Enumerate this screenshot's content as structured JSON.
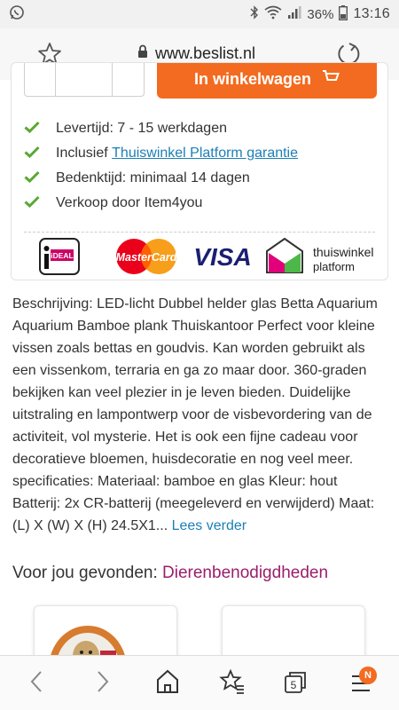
{
  "status_bar": {
    "battery": "36%",
    "time": "13:16"
  },
  "browser": {
    "url": "www.beslist.nl",
    "tab_count": "5",
    "menu_badge": "N"
  },
  "product": {
    "cart_button_label": "In winkelwagen",
    "features": [
      {
        "prefix": "Levertijd: 7 - 15 werkdagen",
        "link": ""
      },
      {
        "prefix": "Inclusief ",
        "link": "Thuiswinkel Platform garantie"
      },
      {
        "prefix": "Bedenktijd: minimaal 14 dagen",
        "link": ""
      },
      {
        "prefix": "Verkoop door Item4you",
        "link": ""
      }
    ],
    "payment_logos": {
      "ideal": "iDEAL",
      "mastercard": "MasterCard",
      "visa": "VISA",
      "thuiswinkel_line1": "thuiswinkel",
      "thuiswinkel_line2": "platform"
    }
  },
  "description": {
    "text": "Beschrijving: LED-licht Dubbel helder glas Betta Aquarium Aquarium Bamboe plank Thuiskantoor Perfect voor kleine vissen zoals bettas en goudvis. Kan worden gebruikt als een vissenkom, terraria en ga zo maar door. 360-graden bekijken kan veel plezier in je leven bieden. Duidelijke uitstraling en lampontwerp voor de visbevordering van de activiteit, vol mysterie. Het is ook een fijne cadeau voor decoratieve bloemen, huisdecoratie en nog veel meer. specificaties: Materiaal: bamboe en glas Kleur: hout Batterij: 2x CR-batterij (meegeleverd en verwijderd) Maat: (L) X (W) X (H) 24.5X1...",
    "read_more": "Lees verder"
  },
  "found": {
    "prefix": "Voor jou gevonden: ",
    "category": "Dierenbenodigdheden"
  },
  "colors": {
    "accent_orange": "#f36b20",
    "link_blue": "#1d7fb5",
    "category_purple": "#9b1d6b",
    "check_green": "#5aa832"
  }
}
